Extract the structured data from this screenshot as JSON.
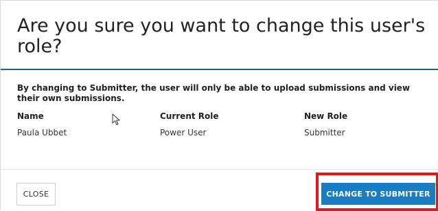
{
  "dialog": {
    "title": "Are you sure you want to change this user's role?",
    "message": "By changing to Submitter, the user will only be able to upload submissions and view their own submissions.",
    "columns": {
      "name_header": "Name",
      "current_role_header": "Current Role",
      "new_role_header": "New Role"
    },
    "row": {
      "name": "Paula Ubbet",
      "current_role": "Power User",
      "new_role": "Submitter"
    },
    "buttons": {
      "close_label": "CLOSE",
      "confirm_label": "CHANGE TO SUBMITTER"
    }
  },
  "colors": {
    "primary": "#1a7dbf",
    "header_rule": "#1f5f8b",
    "highlight": "#e8141c"
  },
  "icons": {
    "cursor": "mouse-pointer-icon"
  }
}
